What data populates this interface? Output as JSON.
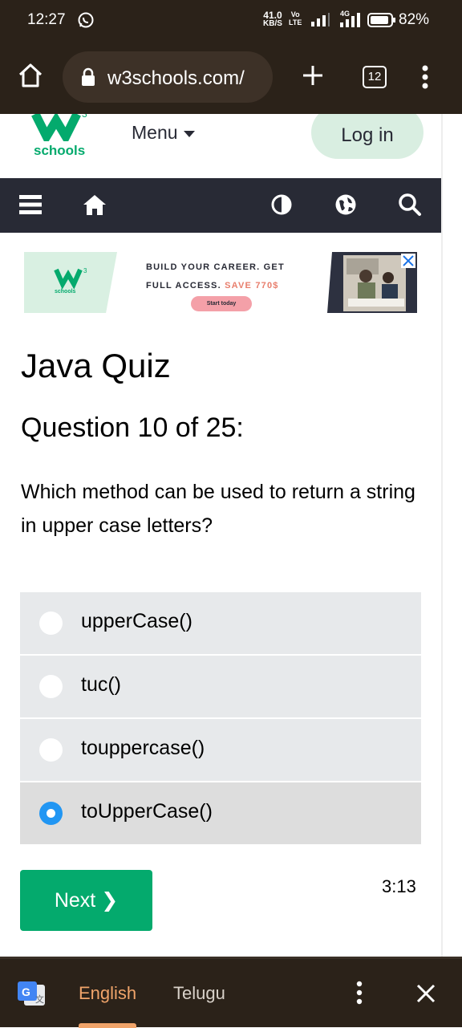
{
  "status_bar": {
    "time": "12:27",
    "net_speed_value": "41.0",
    "net_speed_unit": "KB/S",
    "volte_top": "Vo",
    "volte_bottom": "LTE",
    "network_type": "4G",
    "battery": "82%"
  },
  "browser": {
    "url": "w3schools.com/",
    "tab_count": "12"
  },
  "site_header": {
    "logo_text": "schools",
    "menu_label": "Menu",
    "login_label": "Log in"
  },
  "ad": {
    "logo_text": "schools",
    "line1": "BUILD YOUR CAREER. GET",
    "line2_prefix": "FULL ACCESS.",
    "line2_save": "SAVE 770$",
    "cta": "Start today"
  },
  "quiz": {
    "title": "Java Quiz",
    "question_heading": "Question 10 of 25:",
    "question_text": "Which method can be used to return a string in upper case letters?",
    "options": [
      {
        "label": "upperCase()",
        "selected": false
      },
      {
        "label": "tuc()",
        "selected": false
      },
      {
        "label": "touppercase()",
        "selected": false
      },
      {
        "label": "toUpperCase()",
        "selected": true
      }
    ],
    "next_label": "Next ❯",
    "timer": "3:13"
  },
  "translate_bar": {
    "source_language": "English",
    "target_language": "Telugu"
  },
  "colors": {
    "brand_green": "#04aa6d",
    "nav_dark": "#282a35",
    "radio_selected": "#2196f3",
    "chrome_bar": "#2b2219",
    "translate_accent": "#f0a46a"
  }
}
